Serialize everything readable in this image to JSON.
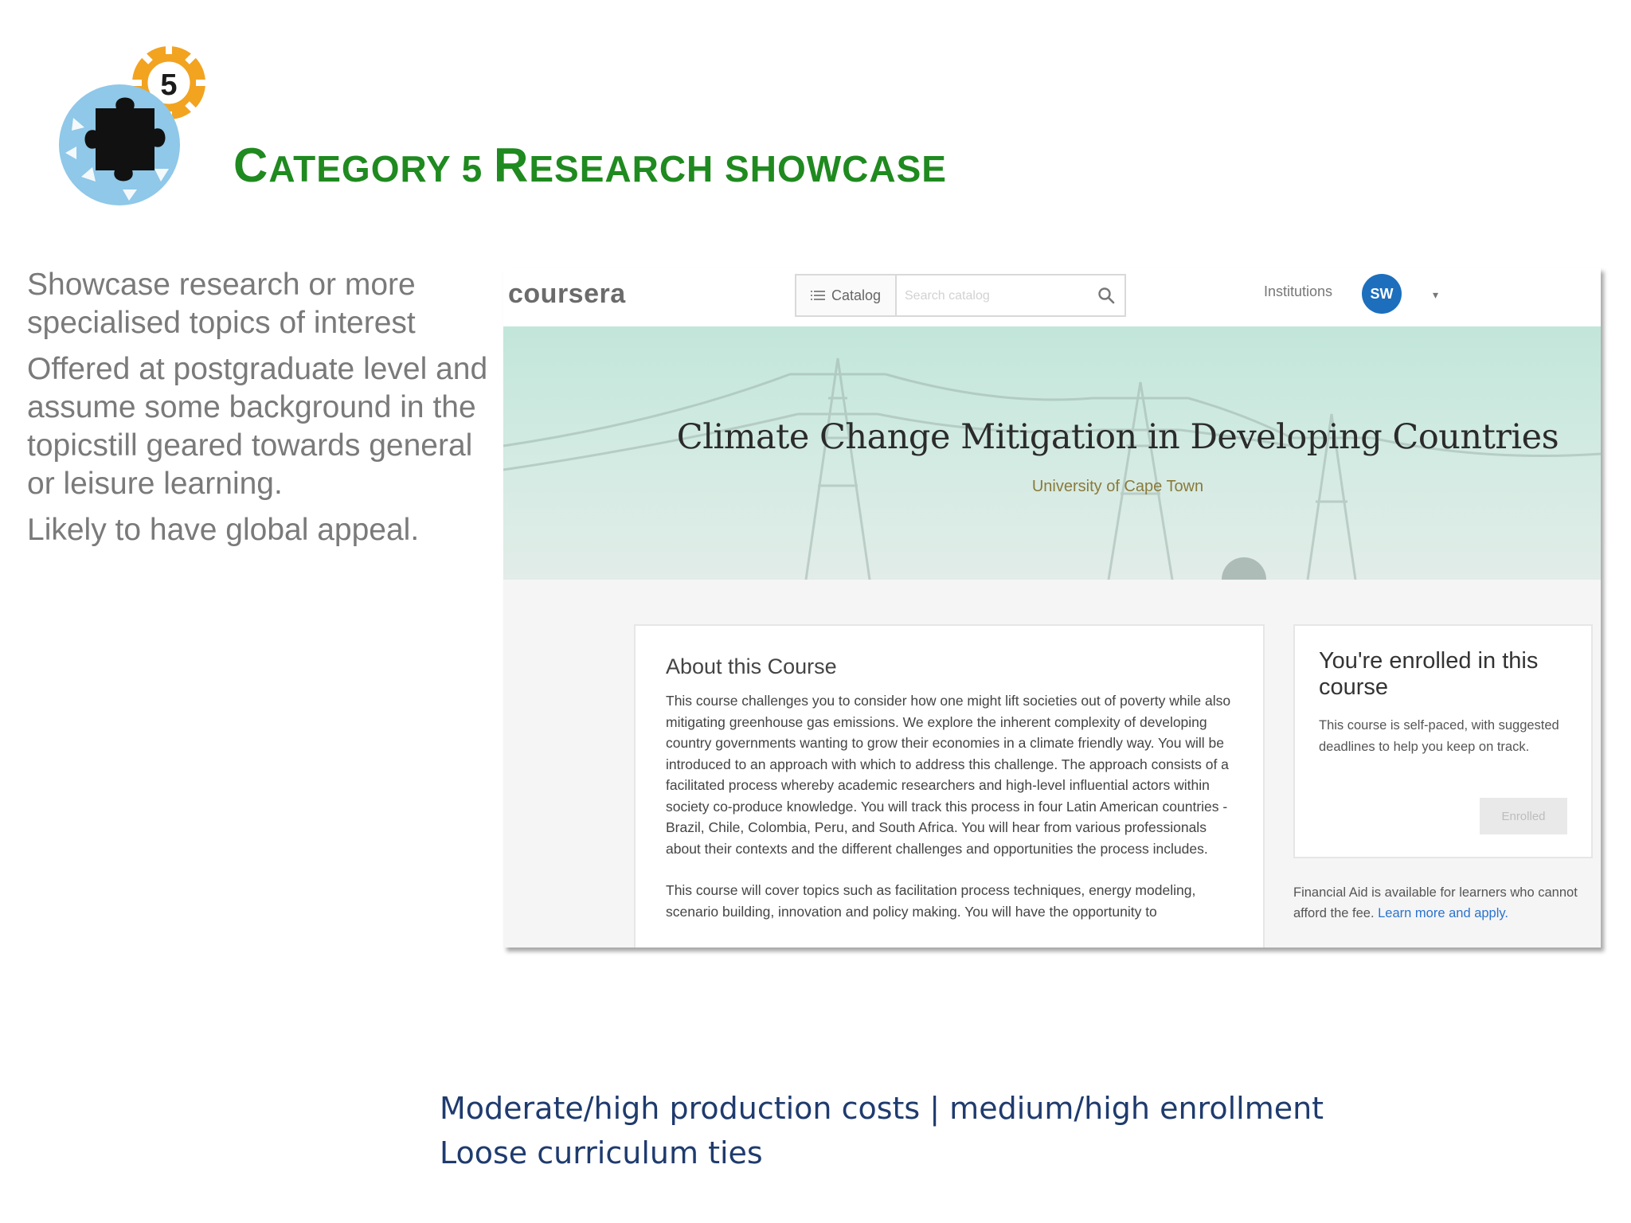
{
  "slide": {
    "badge_number": "5",
    "title_cap1": "C",
    "title_rest1": "ATEGORY 5 ",
    "title_cap2": "R",
    "title_rest2": "ESEARCH SHOWCASE",
    "bullets": [
      "Showcase research or more specialised topics of interest",
      "Offered at postgraduate level and assume some background in the topicstill geared towards general or leisure learning.",
      "Likely to have global appeal."
    ],
    "bottom_lines": [
      "Moderate/high production costs | medium/high enrollment",
      "Loose curriculum ties"
    ],
    "colors": {
      "title": "#1f8a1f",
      "body_text": "#7a7a7a",
      "bottom_text": "#1f3b6e"
    }
  },
  "coursera": {
    "brand": "coursera",
    "catalog_label": "Catalog",
    "search_placeholder": "Search catalog",
    "institutions_label": "Institutions",
    "avatar_initials": "SW",
    "caret": "▾",
    "course_title": "Climate Change Mitigation in Developing Countries",
    "university": "University of Cape Town",
    "about": {
      "heading": "About this Course",
      "paragraphs": [
        "This course challenges you to consider how one might lift societies out of poverty while also mitigating greenhouse gas emissions. We explore the inherent complexity of developing country governments wanting to grow their economies in a climate friendly way. You will be introduced to an approach with which to address this challenge. The approach consists of a facilitated process whereby academic researchers and high-level influential actors within society co-produce knowledge. You will track this process in four Latin American countries - Brazil, Chile, Colombia, Peru, and South Africa. You will hear from various professionals about their contexts and the different challenges and opportunities the process includes.",
        "This course will cover topics such as facilitation process techniques, energy modeling, scenario building, innovation and policy making. You will have the opportunity to"
      ]
    },
    "enroll": {
      "heading": "You're enrolled in this course",
      "text": "This course is self-paced, with suggested deadlines to help you keep on track.",
      "button_label": "Enrolled"
    },
    "financial_aid": {
      "text": "Financial Aid is available for learners who cannot afford the fee.",
      "link": "Learn more and apply."
    },
    "colors": {
      "hero_bg": "#c9e8de",
      "avatar_bg": "#1d6fbd",
      "link": "#2a73cc",
      "university": "#8a7a3a"
    }
  }
}
